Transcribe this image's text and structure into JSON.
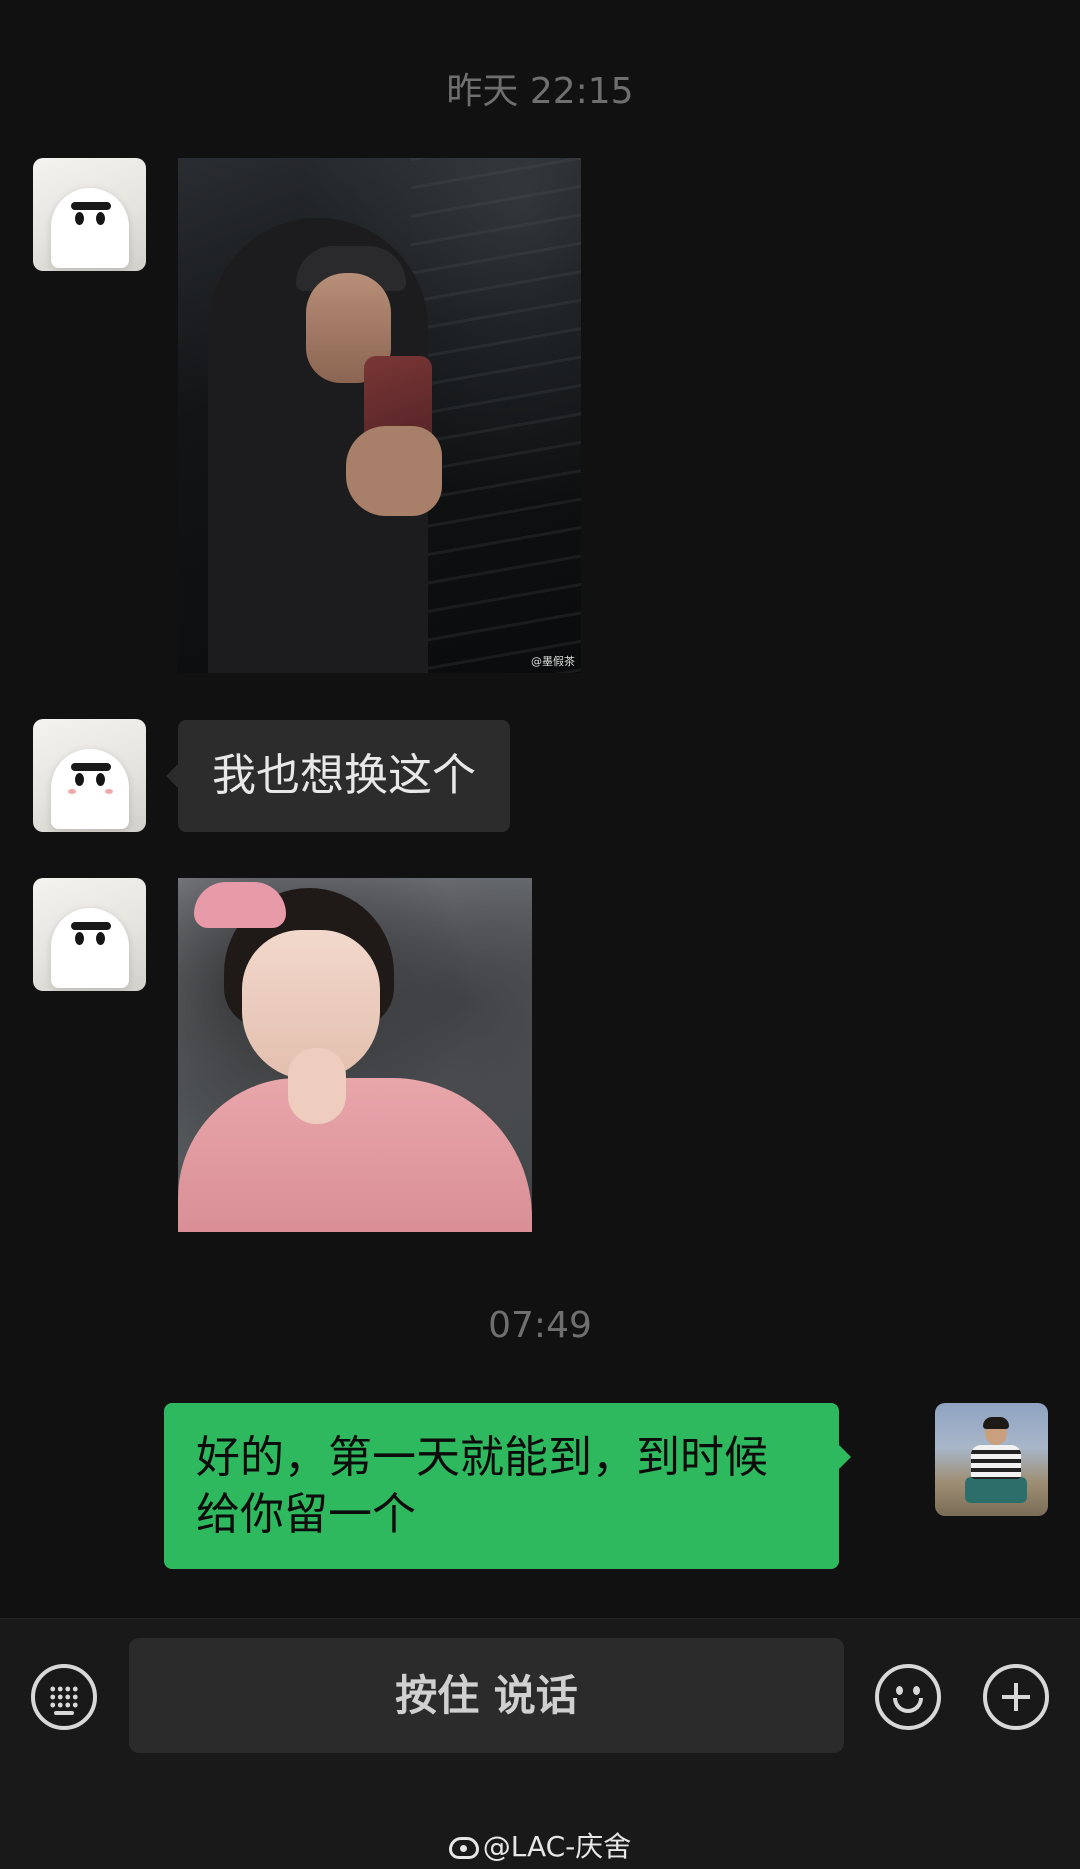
{
  "chat": {
    "timestamps": [
      "昨天 22:15",
      "07:49"
    ],
    "messages": [
      {
        "sender": "contact",
        "type": "image",
        "description_icon": "selfie-photo",
        "watermark": "@墨假茶"
      },
      {
        "sender": "contact",
        "type": "text",
        "text": "我也想换这个"
      },
      {
        "sender": "contact",
        "type": "image",
        "description_icon": "child-photo"
      },
      {
        "sender": "me",
        "type": "text",
        "text": "好的，第一天就能到，到时候给你留一个"
      }
    ]
  },
  "composer": {
    "hold_to_talk_label": "按住 说话",
    "icons": [
      "keyboard-icon",
      "emoji-icon",
      "plus-icon"
    ]
  },
  "footer": {
    "watermark_text": "@LAC-庆舍"
  },
  "colors": {
    "background": "#111111",
    "incoming_bubble": "#2c2c2c",
    "outgoing_bubble": "#2fb95f",
    "timestamp": "#6f6f6f"
  }
}
